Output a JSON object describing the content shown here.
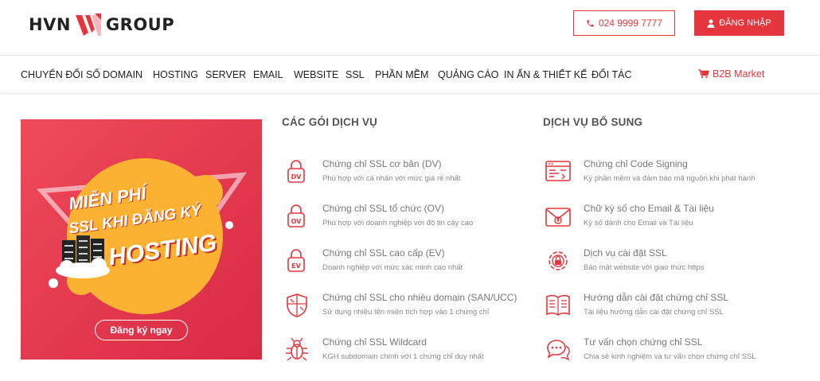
{
  "brand": {
    "left": "HVN",
    "right": "GROUP",
    "accent": "#e5363d"
  },
  "header": {
    "phone_label": "024 9999 7777",
    "login_label": "ĐĂNG NHẬP"
  },
  "nav": {
    "items": [
      "CHUYỂN ĐỔI SỐ",
      "DOMAIN",
      "HOSTING",
      "SERVER",
      "EMAIL",
      "WEBSITE",
      "SSL",
      "PHẦN MỀM",
      "QUẢNG CÁO",
      "IN ẤN & THIẾT KẾ",
      "ĐỐI TÁC"
    ],
    "b2b_label": "B2B Market"
  },
  "banner": {
    "line1": "MIỄN PHÍ",
    "line2": "SSL KHI ĐĂNG KÝ",
    "line3": "HOSTING",
    "cta": "Đăng ký ngay"
  },
  "packages": {
    "title": "CÁC GÓI DỊCH VỤ",
    "items": [
      {
        "name": "Chứng chỉ SSL cơ bản (DV)",
        "desc": "Phù hợp với cá nhân với mức giá rẻ nhất",
        "icon": "lock-dv-icon",
        "badge": "DV"
      },
      {
        "name": "Chứng chỉ SSL tổ chức (OV)",
        "desc": "Phù hợp với doanh nghiệp với độ tin cậy cao",
        "icon": "lock-ov-icon",
        "badge": "OV"
      },
      {
        "name": "Chứng chỉ SSL cao cấp (EV)",
        "desc": "Doanh nghiệp với mức xác minh cao nhất",
        "icon": "lock-ev-icon",
        "badge": "EV"
      },
      {
        "name": "Chứng chỉ SSL cho nhiều domain (SAN/UCC)",
        "desc": "Sử dụng nhiều tên miền tích hợp vào 1 chứng chỉ",
        "icon": "shield-icon"
      },
      {
        "name": "Chứng chỉ SSL Wildcard",
        "desc": "KGH subdomain chính với 1 chứng chỉ duy nhất",
        "icon": "bug-icon"
      }
    ]
  },
  "extras": {
    "title": "DỊCH VỤ BỔ SUNG",
    "items": [
      {
        "name": "Chứng chỉ Code Signing",
        "desc": "Ký phần mềm và đảm bảo mã nguồn khi phát hành",
        "icon": "code-window-icon"
      },
      {
        "name": "Chữ ký số cho Email & Tài liệu",
        "desc": "Ký số dành cho Email và Tài liệu",
        "icon": "email-icon"
      },
      {
        "name": "Dịch vụ cài đặt SSL",
        "desc": "Bảo mật website với giao thức https",
        "icon": "gear-lock-icon"
      },
      {
        "name": "Hướng dẫn cài đặt chứng chỉ SSL",
        "desc": "Tài liệu hướng dẫn cài đặt chứng chỉ SSL",
        "icon": "book-icon"
      },
      {
        "name": "Tư vấn chọn chứng chỉ SSL",
        "desc": "Chia sẻ kinh nghiệm và tư vấn chọn chứng chỉ SSL",
        "icon": "chat-icon"
      }
    ]
  }
}
